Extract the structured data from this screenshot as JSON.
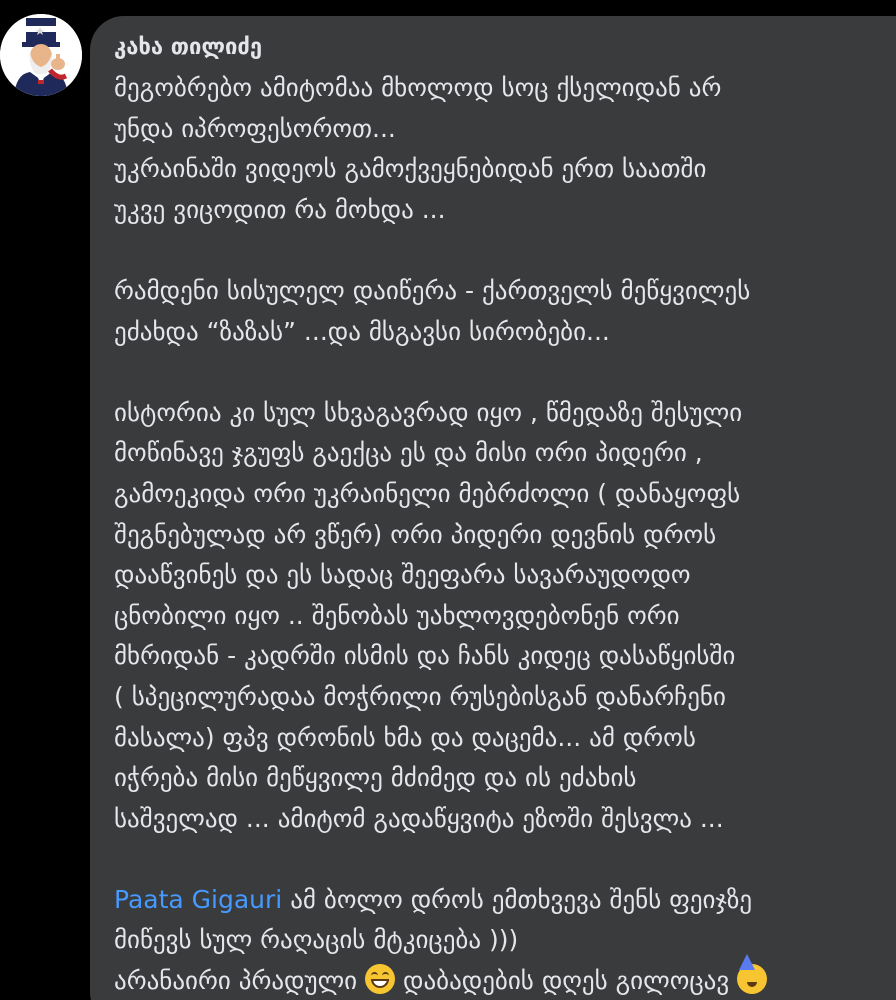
{
  "comment": {
    "avatar_icon": "uncle-sam-avatar",
    "author": "კახა თილიძე",
    "lines": [
      "მეგობრებო ამიტომაა მხოლოდ სოც ქსელიდან არ",
      "უნდა იპროფესოროთ...",
      "უკრაინაში ვიდეოს გამოქვეყნებიდან ერთ საათში",
      "უკვე ვიცოდით რა მოხდა ...",
      "",
      "რამდენი სისულელ დაიწერა - ქართველს მეწყვილეს",
      "ეძახდა “ზაზას” ...და მსგავსი სირობები...",
      "",
      "ისტორია კი სულ სხვაგავრად იყო , წმედაზე შესული",
      "მოწინავე ჯგუფს გაექცა ეს და მისი ორი პიდერი ,",
      "გამოეკიდა ორი უკრაინელი მებრძოლი ( დანაყოფს",
      "შეგნებულად არ ვწერ)  ორი პიდერი დევნის დროს",
      "დააწვინეს და ეს სადაც შეეფარა სავარაუდოდო",
      "ცნობილი იყო  .. შენობას უახლოვდებონენ ორი",
      "მხრიდან - კადრში ისმის და ჩანს კიდეც დასაწყისში",
      "( სპეცილურადაა მოჭრილი რუსებისგან დანარჩენი",
      "მასალა) ფპვ დრონის ხმა და დაცემა... ამ დროს",
      "იჭრება  მისი მეწყვილე მძიმედ და ის ეძახის",
      "საშველად ... ამიტომ გადაწყვიტა ეზოში შესვლა ...",
      ""
    ],
    "mention": "Paata Gigauri",
    "mention_rest": "  ამ ბოლო დროს ემთხვევა შენს ფეიჯზე",
    "line_after_mention": "მიწევს სულ რაღაცის მტკიცება )))",
    "last_line_a": "არანაირი პრადული ",
    "emoji_1": "grinning-face-emoji",
    "last_line_b": " დაბადების დღეს გილოცავ ",
    "emoji_2": "partying-face-emoji"
  },
  "colors": {
    "background": "#000000",
    "bubble": "#3a3b3c",
    "text": "#e4e6eb",
    "mention": "#4599ff"
  }
}
